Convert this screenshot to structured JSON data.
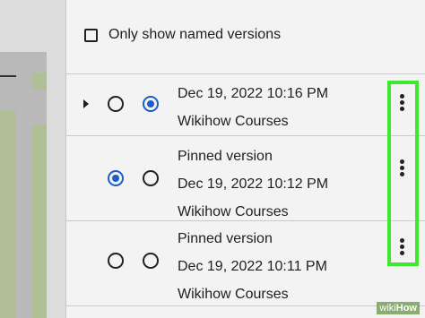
{
  "filter": {
    "label": "Only show named versions",
    "checked": false
  },
  "versions": [
    {
      "name": "",
      "timestamp": "Dec 19, 2022 10:16 PM",
      "author": "Wikihow Courses",
      "expandable": true,
      "radio_a_selected": false,
      "radio_b_selected": true
    },
    {
      "name": "Pinned version",
      "timestamp": "Dec 19, 2022 10:12 PM",
      "author": "Wikihow Courses",
      "expandable": false,
      "radio_a_selected": true,
      "radio_b_selected": false
    },
    {
      "name": "Pinned version",
      "timestamp": "Dec 19, 2022 10:11 PM",
      "author": "Wikihow Courses",
      "expandable": false,
      "radio_a_selected": false,
      "radio_b_selected": false
    }
  ],
  "icons": {
    "more": "more-vertical-icon",
    "expand": "expand-triangle-icon"
  },
  "colors": {
    "accent": "#1a5fc6",
    "highlight": "#3de82f"
  },
  "watermark": {
    "prefix": "wiki",
    "suffix": "How"
  }
}
